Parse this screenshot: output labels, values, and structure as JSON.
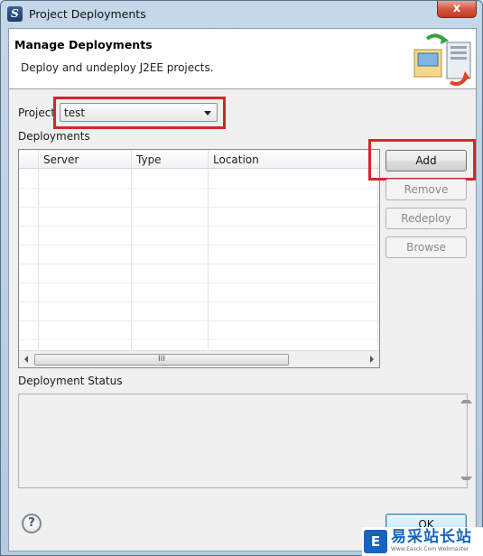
{
  "window": {
    "title": "Project Deployments",
    "app_icon": "S",
    "close_glyph": "x"
  },
  "banner": {
    "title": "Manage Deployments",
    "description": "Deploy and undeploy J2EE projects."
  },
  "project": {
    "label": "Project",
    "value": "test"
  },
  "deployments": {
    "label": "Deployments",
    "columns": [
      "Server",
      "Type",
      "Location"
    ],
    "rows": [],
    "scroll_thumb_grip": "III"
  },
  "buttons": {
    "add": "Add",
    "remove": "Remove",
    "redeploy": "Redeploy",
    "browse": "Browse"
  },
  "status": {
    "label": "Deployment Status",
    "text": ""
  },
  "footer": {
    "help_glyph": "?",
    "ok": "OK"
  },
  "watermark": {
    "logo": "E",
    "text": "易采站长站",
    "sub": "Www.Easck.Com Webmaster"
  },
  "colors": {
    "highlight": "#d6262b",
    "watermark": "#1565c0"
  }
}
